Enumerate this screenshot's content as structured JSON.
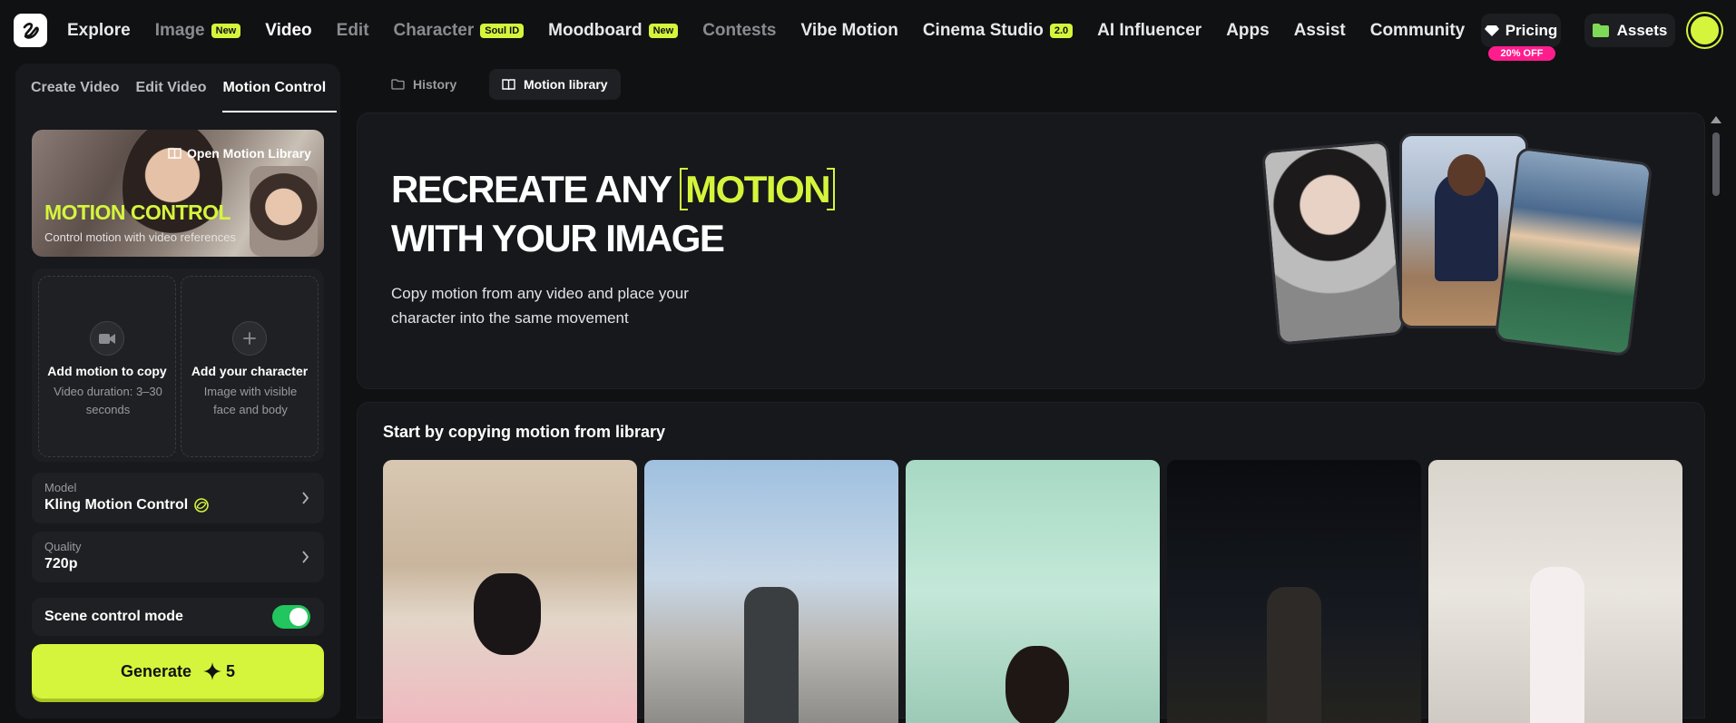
{
  "nav": {
    "items": [
      {
        "label": "Explore",
        "badge": ""
      },
      {
        "label": "Image",
        "badge": "New"
      },
      {
        "label": "Video",
        "badge": ""
      },
      {
        "label": "Edit",
        "badge": ""
      },
      {
        "label": "Character",
        "badge": "Soul ID"
      },
      {
        "label": "Moodboard",
        "badge": "New"
      },
      {
        "label": "Contests",
        "badge": ""
      },
      {
        "label": "Vibe Motion",
        "badge": ""
      },
      {
        "label": "Cinema Studio",
        "badge": "2.0"
      },
      {
        "label": "AI Influencer",
        "badge": ""
      },
      {
        "label": "Apps",
        "badge": ""
      },
      {
        "label": "Assist",
        "badge": ""
      },
      {
        "label": "Community",
        "badge": ""
      }
    ],
    "pricing_label": "Pricing",
    "discount_badge": "20% OFF",
    "assets_label": "Assets"
  },
  "left_panel": {
    "tabs": [
      "Create Video",
      "Edit Video",
      "Motion Control"
    ],
    "motion_card": {
      "open_library": "Open Motion Library",
      "title": "MOTION CONTROL",
      "subtitle": "Control motion with video references"
    },
    "upload_motion": {
      "title": "Add motion to copy",
      "subtitle": "Video duration: 3–30 seconds"
    },
    "upload_character": {
      "title": "Add your character",
      "subtitle": "Image with visible face and body"
    },
    "model": {
      "label": "Model",
      "value": "Kling Motion Control"
    },
    "quality": {
      "label": "Quality",
      "value": "720p"
    },
    "scene_control": {
      "label": "Scene control mode",
      "enabled": true
    },
    "generate": {
      "label": "Generate",
      "cost": "5"
    }
  },
  "main": {
    "tabs": [
      "History",
      "Motion library"
    ],
    "hero": {
      "line1_prefix": "RECREATE ANY",
      "line1_highlight": "MOTION",
      "line2": "WITH YOUR IMAGE",
      "description": "Copy motion from any video and place your character into the same movement"
    },
    "library_title": "Start by copying motion from library"
  },
  "colors": {
    "accent": "#d5f53c",
    "discount": "#ff1d8e",
    "toggle_on": "#22c55e",
    "background": "#101113"
  }
}
